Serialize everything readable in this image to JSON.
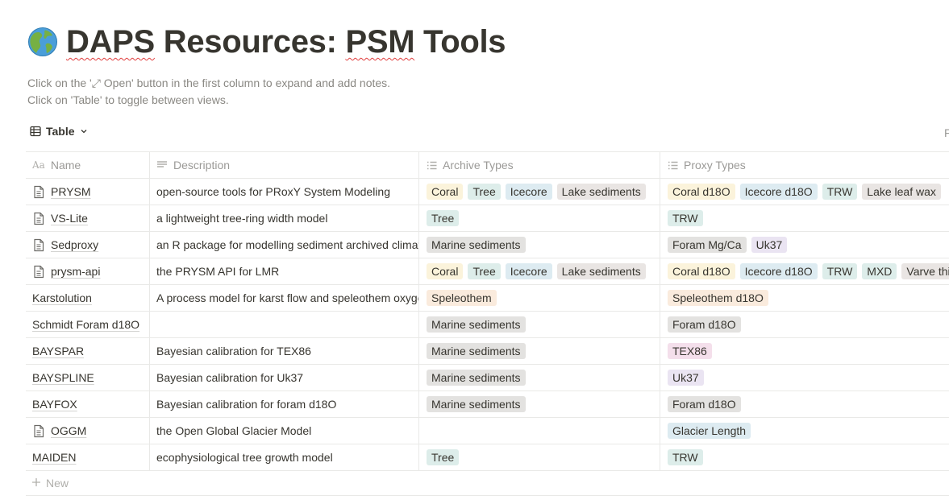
{
  "page": {
    "icon": "globe-americas-icon",
    "title_part1": "DAPS",
    "title_part2": " Resources: ",
    "title_part3": "PSM",
    "title_part4": " Tools",
    "description_line1": "Click on the '⤢ Open' button in the first column to expand and add notes.",
    "description_line2": "Click on 'Table' to toggle between views."
  },
  "view": {
    "label": "Table",
    "icon": "table-icon",
    "edge_fragment": "F"
  },
  "columns": {
    "name": "Name",
    "description": "Description",
    "archive_types": "Archive Types",
    "proxy_types": "Proxy Types"
  },
  "tag_colors": {
    "yellow": "#fbf3db",
    "green": "#ddedea",
    "blue": "#ddebf1",
    "brown": "#e9e5e3",
    "gray": "#e3e2e0",
    "orange": "#faebdd",
    "pink": "#f4dfeb",
    "purple": "#eae4f2",
    "red": "#ffe2dd"
  },
  "rows": [
    {
      "name": "PRYSM",
      "has_doc": true,
      "description": "open-source tools for PRoxY System Modeling",
      "archive": [
        {
          "label": "Coral",
          "color": "#fbf3db"
        },
        {
          "label": "Tree",
          "color": "#ddedea"
        },
        {
          "label": "Icecore",
          "color": "#ddebf1"
        },
        {
          "label": "Lake sediments",
          "color": "#e9e5e3"
        }
      ],
      "proxy": [
        {
          "label": "Coral d18O",
          "color": "#fbf3db"
        },
        {
          "label": "Icecore d18O",
          "color": "#ddebf1"
        },
        {
          "label": "TRW",
          "color": "#ddedea"
        },
        {
          "label": "Lake leaf wax",
          "color": "#e9e5e3"
        }
      ]
    },
    {
      "name": "VS-Lite",
      "has_doc": true,
      "description": "a lightweight tree-ring width model",
      "archive": [
        {
          "label": "Tree",
          "color": "#ddedea"
        }
      ],
      "proxy": [
        {
          "label": "TRW",
          "color": "#ddedea"
        }
      ]
    },
    {
      "name": "Sedproxy",
      "has_doc": true,
      "description": "an R package for modelling sediment archived climate",
      "archive": [
        {
          "label": "Marine sediments",
          "color": "#e3e2e0"
        }
      ],
      "proxy": [
        {
          "label": "Foram Mg/Ca",
          "color": "#e3e2e0"
        },
        {
          "label": "Uk37",
          "color": "#eae4f2"
        }
      ]
    },
    {
      "name": "prysm-api",
      "has_doc": true,
      "description": "the PRYSM API for LMR",
      "archive": [
        {
          "label": "Coral",
          "color": "#fbf3db"
        },
        {
          "label": "Tree",
          "color": "#ddedea"
        },
        {
          "label": "Icecore",
          "color": "#ddebf1"
        },
        {
          "label": "Lake sediments",
          "color": "#e9e5e3"
        }
      ],
      "proxy": [
        {
          "label": "Coral d18O",
          "color": "#fbf3db"
        },
        {
          "label": "Icecore d18O",
          "color": "#ddebf1"
        },
        {
          "label": "TRW",
          "color": "#ddedea"
        },
        {
          "label": "MXD",
          "color": "#ddedea"
        },
        {
          "label": "Varve thickness",
          "color": "#e9e5e3"
        }
      ]
    },
    {
      "name": "Karstolution",
      "has_doc": false,
      "description": "A process model for karst flow and speleothem oxygen isotopes",
      "archive": [
        {
          "label": "Speleothem",
          "color": "#faebdd"
        }
      ],
      "proxy": [
        {
          "label": "Speleothem d18O",
          "color": "#faebdd"
        }
      ]
    },
    {
      "name": "Schmidt Foram d18O",
      "has_doc": false,
      "description": "",
      "archive": [
        {
          "label": "Marine sediments",
          "color": "#e3e2e0"
        }
      ],
      "proxy": [
        {
          "label": "Foram d18O",
          "color": "#e3e2e0"
        }
      ]
    },
    {
      "name": "BAYSPAR",
      "has_doc": false,
      "description": "Bayesian calibration for TEX86",
      "archive": [
        {
          "label": "Marine sediments",
          "color": "#e3e2e0"
        }
      ],
      "proxy": [
        {
          "label": "TEX86",
          "color": "#f4dfeb"
        }
      ]
    },
    {
      "name": "BAYSPLINE",
      "has_doc": false,
      "description": "Bayesian calibration for Uk37",
      "archive": [
        {
          "label": "Marine sediments",
          "color": "#e3e2e0"
        }
      ],
      "proxy": [
        {
          "label": "Uk37",
          "color": "#eae4f2"
        }
      ]
    },
    {
      "name": "BAYFOX",
      "has_doc": false,
      "description": "Bayesian calibration for foram d18O",
      "archive": [
        {
          "label": "Marine sediments",
          "color": "#e3e2e0"
        }
      ],
      "proxy": [
        {
          "label": "Foram d18O",
          "color": "#e3e2e0"
        }
      ]
    },
    {
      "name": "OGGM",
      "has_doc": true,
      "description": "the Open Global Glacier Model",
      "archive": [],
      "proxy": [
        {
          "label": "Glacier Length",
          "color": "#ddebf1"
        }
      ]
    },
    {
      "name": "MAIDEN",
      "has_doc": false,
      "description": "ecophysiological tree growth model",
      "archive": [
        {
          "label": "Tree",
          "color": "#ddedea"
        }
      ],
      "proxy": [
        {
          "label": "TRW",
          "color": "#ddedea"
        }
      ]
    }
  ],
  "new_row_label": "New"
}
